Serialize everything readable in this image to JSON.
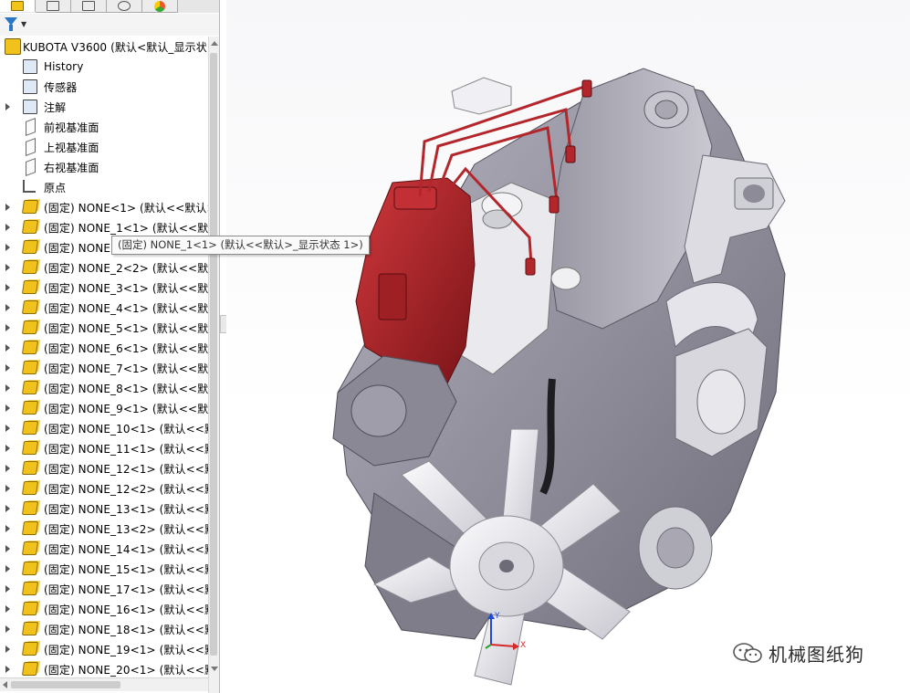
{
  "tabs": [
    {
      "name": "feature-manager"
    },
    {
      "name": "property-manager"
    },
    {
      "name": "configuration-manager"
    },
    {
      "name": "dimxpert-manager"
    },
    {
      "name": "display-manager"
    }
  ],
  "tree": {
    "root": "KUBOTA V3600  (默认<默认_显示状",
    "items": [
      {
        "label": "History",
        "icon": "history-icon",
        "expandable": false
      },
      {
        "label": "传感器",
        "icon": "sensor-icon",
        "expandable": false
      },
      {
        "label": "注解",
        "icon": "annotation-icon",
        "expandable": true
      },
      {
        "label": "前视基准面",
        "icon": "plane-icon",
        "expandable": false
      },
      {
        "label": "上视基准面",
        "icon": "plane-icon",
        "expandable": false
      },
      {
        "label": "右视基准面",
        "icon": "plane-icon",
        "expandable": false
      },
      {
        "label": "原点",
        "icon": "origin-icon",
        "expandable": false
      },
      {
        "label": "(固定) NONE<1> (默认<<默认>",
        "icon": "part-icon",
        "expandable": true
      },
      {
        "label": "(固定) NONE_1<1> (默认<<默认",
        "icon": "part-icon",
        "expandable": true
      },
      {
        "label": "(固定) NONE",
        "icon": "part-icon",
        "expandable": true
      },
      {
        "label": "(固定) NONE_2<2> (默认<<默认",
        "icon": "part-icon",
        "expandable": true
      },
      {
        "label": "(固定) NONE_3<1> (默认<<默认",
        "icon": "part-icon",
        "expandable": true
      },
      {
        "label": "(固定) NONE_4<1> (默认<<默认",
        "icon": "part-icon",
        "expandable": true
      },
      {
        "label": "(固定) NONE_5<1> (默认<<默认",
        "icon": "part-icon",
        "expandable": true
      },
      {
        "label": "(固定) NONE_6<1> (默认<<默认",
        "icon": "part-icon",
        "expandable": true
      },
      {
        "label": "(固定) NONE_7<1> (默认<<默认",
        "icon": "part-icon",
        "expandable": true
      },
      {
        "label": "(固定) NONE_8<1> (默认<<默认",
        "icon": "part-icon",
        "expandable": true
      },
      {
        "label": "(固定) NONE_9<1> (默认<<默认",
        "icon": "part-icon",
        "expandable": true
      },
      {
        "label": "(固定) NONE_10<1> (默认<<默",
        "icon": "part-icon",
        "expandable": true
      },
      {
        "label": "(固定) NONE_11<1> (默认<<默",
        "icon": "part-icon",
        "expandable": true
      },
      {
        "label": "(固定) NONE_12<1> (默认<<默",
        "icon": "part-icon",
        "expandable": true
      },
      {
        "label": "(固定) NONE_12<2> (默认<<默",
        "icon": "part-icon",
        "expandable": true
      },
      {
        "label": "(固定) NONE_13<1> (默认<<默",
        "icon": "part-icon",
        "expandable": true
      },
      {
        "label": "(固定) NONE_13<2> (默认<<默",
        "icon": "part-icon",
        "expandable": true
      },
      {
        "label": "(固定) NONE_14<1> (默认<<默",
        "icon": "part-icon",
        "expandable": true
      },
      {
        "label": "(固定) NONE_15<1> (默认<<默",
        "icon": "part-icon",
        "expandable": true
      },
      {
        "label": "(固定) NONE_17<1> (默认<<默",
        "icon": "part-icon",
        "expandable": true
      },
      {
        "label": "(固定) NONE_16<1> (默认<<默",
        "icon": "part-icon",
        "expandable": true
      },
      {
        "label": "(固定) NONE_18<1> (默认<<默",
        "icon": "part-icon",
        "expandable": true
      },
      {
        "label": "(固定) NONE_19<1> (默认<<默",
        "icon": "part-icon",
        "expandable": true
      },
      {
        "label": "(固定) NONE_20<1> (默认<<默",
        "icon": "part-icon",
        "expandable": true
      }
    ]
  },
  "tooltip": "(固定) NONE_1<1> (默认<<默认>_显示状态 1>)",
  "triad": {
    "x_label": "X",
    "y_label": "Y"
  },
  "watermark": "机械图纸狗",
  "colors": {
    "engine_body": "#8d8b98",
    "pump_red": "#b3262b",
    "fan_white": "#ececf0",
    "accent_blue": "#2b76c6"
  }
}
